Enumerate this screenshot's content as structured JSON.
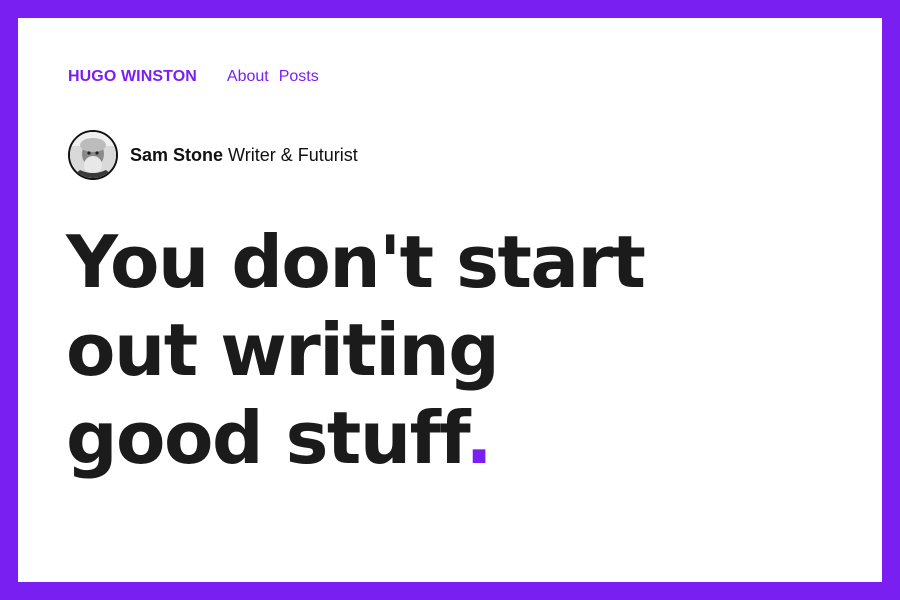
{
  "nav": {
    "brand": "HUGO WINSTON",
    "links": [
      {
        "label": "About"
      },
      {
        "label": "Posts"
      }
    ]
  },
  "author": {
    "name": "Sam Stone",
    "role": "Writer & Futurist"
  },
  "headline": {
    "lines": [
      "You don't start",
      "out writing",
      "good stuff"
    ],
    "accent": "."
  },
  "colors": {
    "accent": "#7a1ff2",
    "text": "#1b1b1b",
    "background": "#ffffff"
  }
}
